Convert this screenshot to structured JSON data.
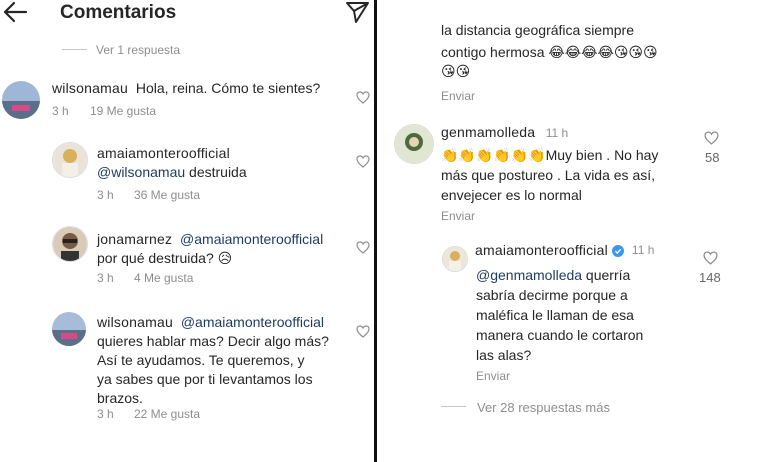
{
  "left": {
    "header": {
      "title": "Comentarios"
    },
    "view_replies": "Ver 1 respuesta",
    "comments": [
      {
        "user": "wilsonamau",
        "text": "Hola, reina. Cómo te sientes?",
        "time": "3 h",
        "likes": "19 Me gusta"
      },
      {
        "user": "amaiamonteroofficial",
        "mention": "@wilsonamau",
        "text": " destruida",
        "time": "3 h",
        "likes": "36 Me gusta"
      },
      {
        "user": "jonamarnez",
        "mention": "@amaiamonteroofficial",
        "text_line2": "por qué destruida?",
        "emoji": "😥",
        "time": "3 h",
        "likes": "4 Me gusta"
      },
      {
        "user": "wilsonamau",
        "mention": "@amaiamonteroofficial",
        "lines": [
          "quieres hablar mas? Decir algo más?",
          "Así te ayudamos. Te queremos, y",
          "ya sabes que por ti levantamos los",
          "brazos."
        ],
        "time": "3 h",
        "likes": "22 Me gusta"
      }
    ]
  },
  "right": {
    "top_comment": {
      "lines": [
        "la distancia geográfica siempre",
        "contigo hermosa"
      ],
      "emoji_line1": "😂😂😂😂😘😘😘",
      "emoji_line2": "😘😘",
      "send": "Enviar"
    },
    "comment2": {
      "user": "genmamolleda",
      "time": "11 h",
      "claps": "👏👏👏👏👏👏",
      "lines": [
        "Muy bien . No hay",
        "más que postureo . La vida es así,",
        "envejecer es lo normal"
      ],
      "send": "Enviar",
      "likes": "58"
    },
    "reply": {
      "user": "amaiamonteroofficial",
      "time": "11 h",
      "mention": "@genmamolleda",
      "first": " querría",
      "lines": [
        "sabría decirme porque a",
        "maléfica le llaman  de esa",
        "manera cuando le cortaron",
        "las alas?"
      ],
      "send": "Enviar",
      "likes": "148"
    },
    "more_replies": "Ver 28 respuestas más"
  },
  "colors": {
    "text": "#262626",
    "meta": "#8e8e8e",
    "mention": "#1e3a5f",
    "verified": "#3897f0"
  }
}
